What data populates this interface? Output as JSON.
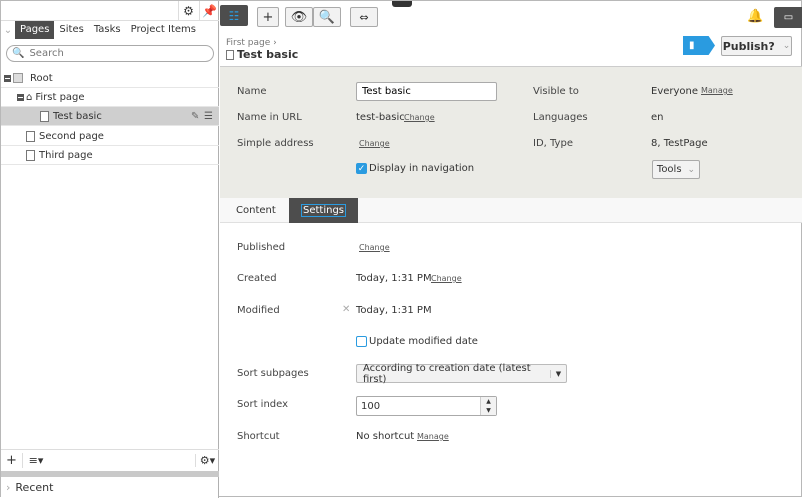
{
  "left": {
    "tabs": [
      "Pages",
      "Sites",
      "Tasks",
      "Project Items"
    ],
    "search_placeholder": "Search",
    "tree": [
      {
        "label": "Root"
      },
      {
        "label": "First page"
      },
      {
        "label": "Test basic"
      },
      {
        "label": "Second page"
      },
      {
        "label": "Third page"
      }
    ],
    "recent": "Recent"
  },
  "breadcrumb": {
    "parent": "First page",
    "current": "Test basic"
  },
  "publish_label": "Publish?",
  "props": {
    "name_label": "Name",
    "name_value": "Test basic",
    "url_label": "Name in URL",
    "url_value": "test-basic",
    "change": "Change",
    "simple_label": "Simple address",
    "display_nav": "Display in navigation",
    "visible_label": "Visible to",
    "visible_value": "Everyone",
    "manage": "Manage",
    "lang_label": "Languages",
    "lang_value": "en",
    "id_label": "ID, Type",
    "id_value": "8, TestPage",
    "tools": "Tools"
  },
  "content_tabs": [
    "Content",
    "Settings"
  ],
  "settings": {
    "published": "Published",
    "created": "Created",
    "created_value": "Today, 1:31 PM",
    "modified": "Modified",
    "modified_value": "Today, 1:31 PM",
    "update_modified": "Update modified date",
    "sort_sub": "Sort subpages",
    "sort_sub_value": "According to creation date (latest first)",
    "sort_index": "Sort index",
    "sort_index_value": "100",
    "shortcut": "Shortcut",
    "shortcut_value": "No shortcut"
  },
  "colors": {
    "accent": "#2a9be0",
    "dark": "#4d4d4d",
    "panel": "#ebebe6"
  }
}
